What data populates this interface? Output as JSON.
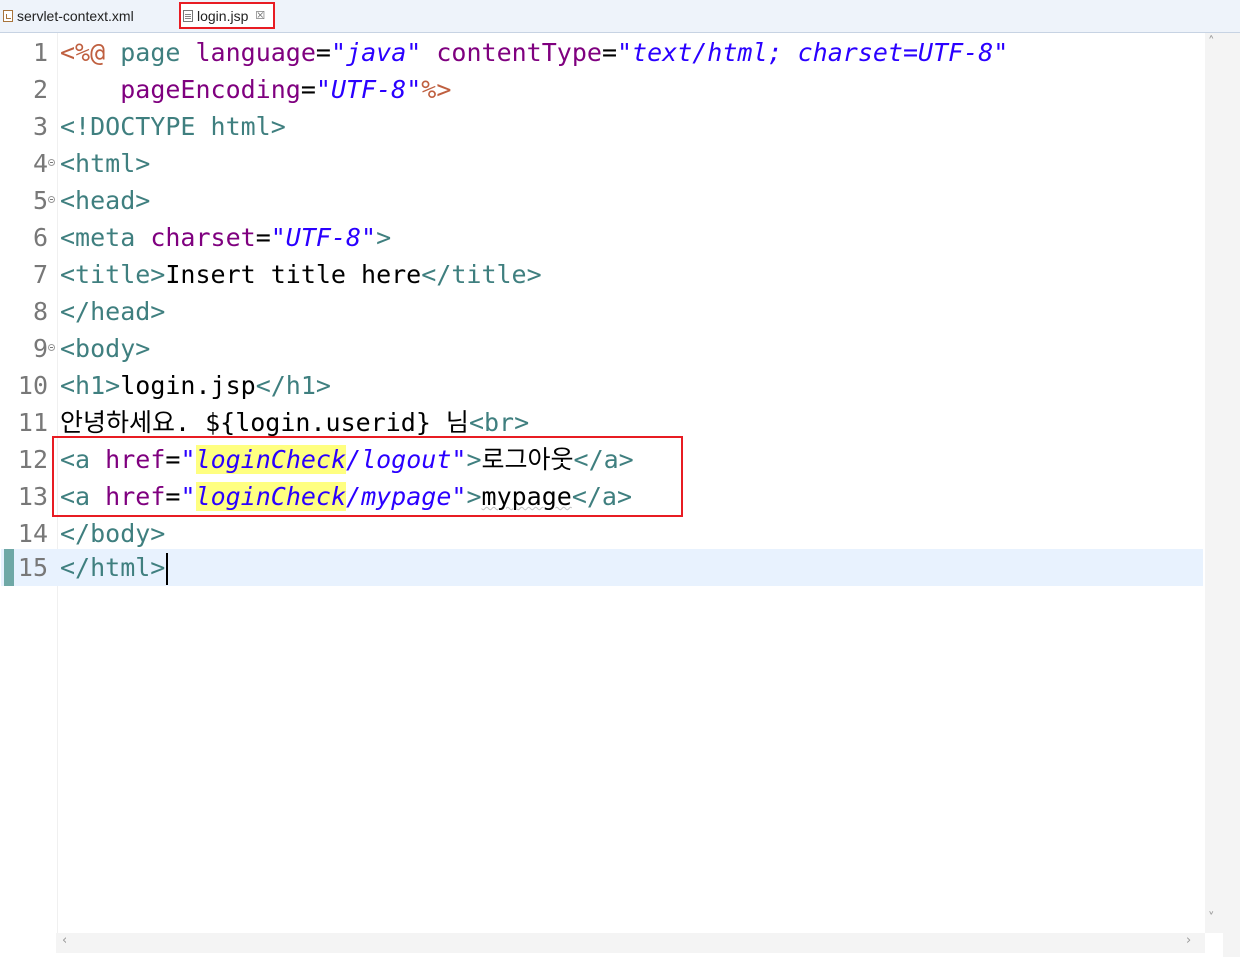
{
  "tabs": [
    {
      "label": "servlet-context.xml",
      "icon": "xml-file-icon",
      "active": false
    },
    {
      "label": "login.jsp",
      "icon": "jsp-file-icon",
      "active": true,
      "close": "☒"
    }
  ],
  "lines": {
    "n1": "1",
    "n2": "2",
    "n3": "3",
    "n4": "4",
    "n5": "5",
    "n6": "6",
    "n7": "7",
    "n8": "8",
    "n9": "9",
    "n10": "10",
    "n11": "11",
    "n12": "12",
    "n13": "13",
    "n14": "14",
    "n15": "15"
  },
  "code": {
    "l1": {
      "open": "<%@",
      "kw": "page",
      "a1": "language",
      "eq": "=",
      "v1": "\"java\"",
      "a2": "contentType",
      "v2": "\"text/html; charset=UTF-8\""
    },
    "l2": {
      "a": "pageEncoding",
      "eq": "=",
      "v": "\"UTF-8\"",
      "close": "%>"
    },
    "l3": {
      "t": "<!DOCTYPE html>"
    },
    "l4": {
      "t": "<html>"
    },
    "l5": {
      "t": "<head>"
    },
    "l6": {
      "t1": "<meta",
      "a": "charset",
      "eq": "=",
      "v": "\"UTF-8\"",
      "t2": ">"
    },
    "l7": {
      "t1": "<title>",
      "text": "Insert title here",
      "t2": "</title>"
    },
    "l8": {
      "t": "</head>"
    },
    "l9": {
      "t": "<body>"
    },
    "l10": {
      "t1": "<h1>",
      "text": "login.jsp",
      "t2": "</h1>"
    },
    "l11": {
      "text": "안녕하세요. ${login.userid} 님",
      "t": "<br>"
    },
    "l12": {
      "t1": "<a",
      "a": "href",
      "eq": "=",
      "q": "\"",
      "hl": "loginCheck",
      "rest": "/logout\"",
      "t2": ">",
      "text": "로그아웃",
      "t3": "</a>"
    },
    "l13": {
      "t1": "<a",
      "a": "href",
      "eq": "=",
      "q": "\"",
      "hl": "loginCheck",
      "rest": "/mypage\"",
      "t2": ">",
      "text": "mypage",
      "t3": "</a>"
    },
    "l14": {
      "t": "</body>"
    },
    "l15": {
      "t": "</html>"
    }
  },
  "scroll": {
    "up": "˄",
    "down": "˅",
    "left": "‹",
    "right": "›"
  },
  "colors": {
    "tag": "#3f7f7f",
    "attr": "#7f007f",
    "string": "#2a00ff",
    "directive": "#bf5f3f",
    "highlight": "#ffff80",
    "annotation": "#e81c23"
  }
}
